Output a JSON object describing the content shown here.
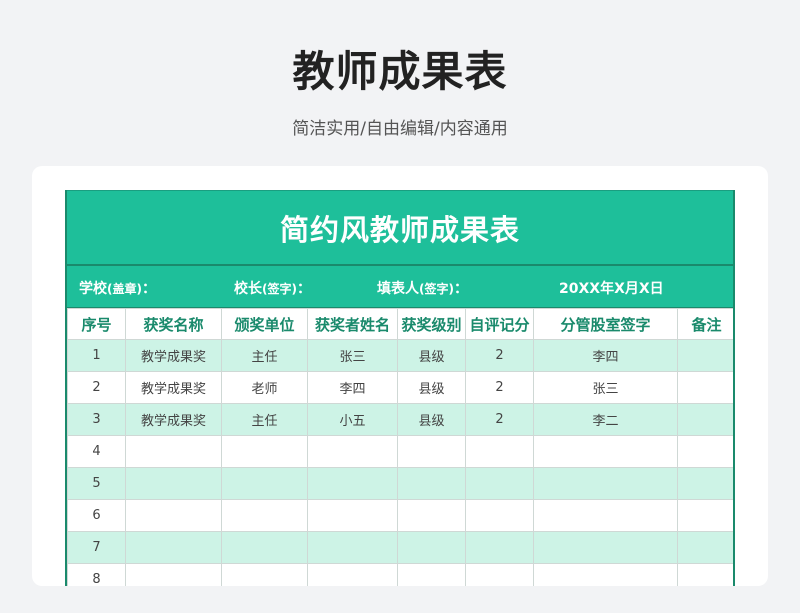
{
  "page": {
    "title": "教师成果表",
    "subtitle": "简洁实用/自由编辑/内容通用"
  },
  "sheet": {
    "banner_title": "简约风教师成果表",
    "meta": {
      "school_label": "学校",
      "school_note": "(盖章)",
      "school_colon": "：",
      "principal_label": "校长",
      "principal_note": "(签字)",
      "principal_colon": "：",
      "filler_label": "填表人",
      "filler_note": "(签字)",
      "filler_colon": "：",
      "date": "20XX年X月X日"
    },
    "columns": [
      "序号",
      "获奖名称",
      "颁奖单位",
      "获奖者姓名",
      "获奖级别",
      "自评记分",
      "分管股室签字",
      "备注"
    ],
    "rows": [
      [
        "1",
        "教学成果奖",
        "主任",
        "张三",
        "县级",
        "2",
        "李四",
        ""
      ],
      [
        "2",
        "教学成果奖",
        "老师",
        "李四",
        "县级",
        "2",
        "张三",
        ""
      ],
      [
        "3",
        "教学成果奖",
        "主任",
        "小五",
        "县级",
        "2",
        "李二",
        ""
      ],
      [
        "4",
        "",
        "",
        "",
        "",
        "",
        "",
        ""
      ],
      [
        "5",
        "",
        "",
        "",
        "",
        "",
        "",
        ""
      ],
      [
        "6",
        "",
        "",
        "",
        "",
        "",
        "",
        ""
      ],
      [
        "7",
        "",
        "",
        "",
        "",
        "",
        "",
        ""
      ],
      [
        "8",
        "",
        "",
        "",
        "",
        "",
        "",
        ""
      ]
    ]
  },
  "colors": {
    "accent": "#1ebf9a",
    "accent_dark": "#1a8a6c",
    "row_alt": "#cdf3e6"
  }
}
